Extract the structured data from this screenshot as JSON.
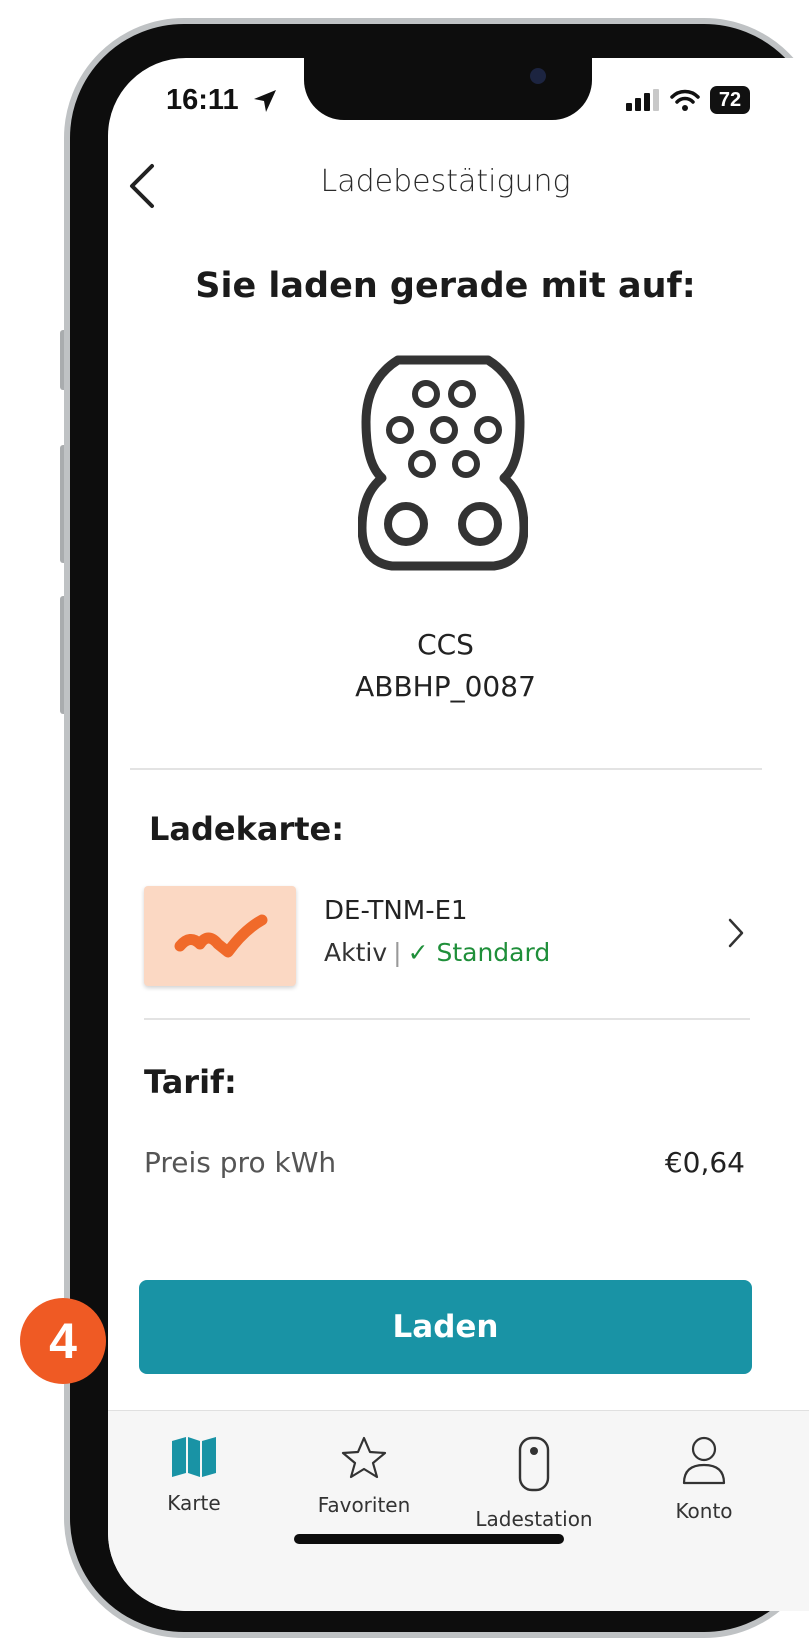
{
  "status_bar": {
    "time": "16:11",
    "battery": "72"
  },
  "header": {
    "title": "Ladebestätigung"
  },
  "charging": {
    "intro": "Sie laden gerade mit auf:",
    "plug_type": "CCS",
    "station_id": "ABBHP_0087"
  },
  "card_section": {
    "heading": "Ladekarte:",
    "card_id": "DE-TNM-E1",
    "status": "Aktiv",
    "separator": "|",
    "check": "✓",
    "default_label": "Standard"
  },
  "tarif": {
    "heading": "Tarif:",
    "price_label": "Preis pro kWh",
    "price_value": "€0,64"
  },
  "action": {
    "button_label": "Laden"
  },
  "tabbar": {
    "items": [
      {
        "label": "Karte",
        "icon": "map-icon"
      },
      {
        "label": "Favoriten",
        "icon": "star-icon"
      },
      {
        "label": "Ladestation",
        "icon": "charger-icon"
      },
      {
        "label": "Konto",
        "icon": "person-icon"
      }
    ]
  },
  "overlay": {
    "step_number": "4"
  },
  "colors": {
    "accent": "#1993a5",
    "success": "#1f8f3a",
    "badge": "#ef5a24"
  }
}
